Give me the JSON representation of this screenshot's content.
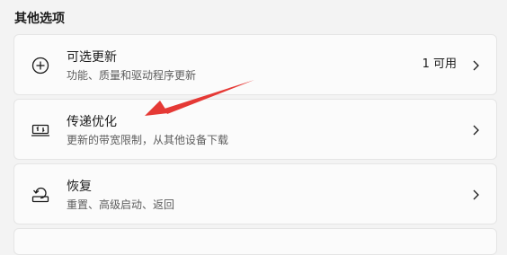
{
  "section": {
    "title": "其他选项"
  },
  "cards": [
    {
      "title": "可选更新",
      "description": "功能、质量和驱动程序更新",
      "value": "1 可用",
      "icon": "plus-circle-icon"
    },
    {
      "title": "传递优化",
      "description": "更新的带宽限制，从其他设备下载",
      "icon": "delivery-optimization-icon"
    },
    {
      "title": "恢复",
      "description": "重置、高级启动、返回",
      "icon": "recovery-icon"
    }
  ],
  "annotation": {
    "arrow_color": "#e53935"
  },
  "colors": {
    "background": "#f3f3f3",
    "card": "#fbfbfb",
    "border": "#e5e5e5"
  }
}
